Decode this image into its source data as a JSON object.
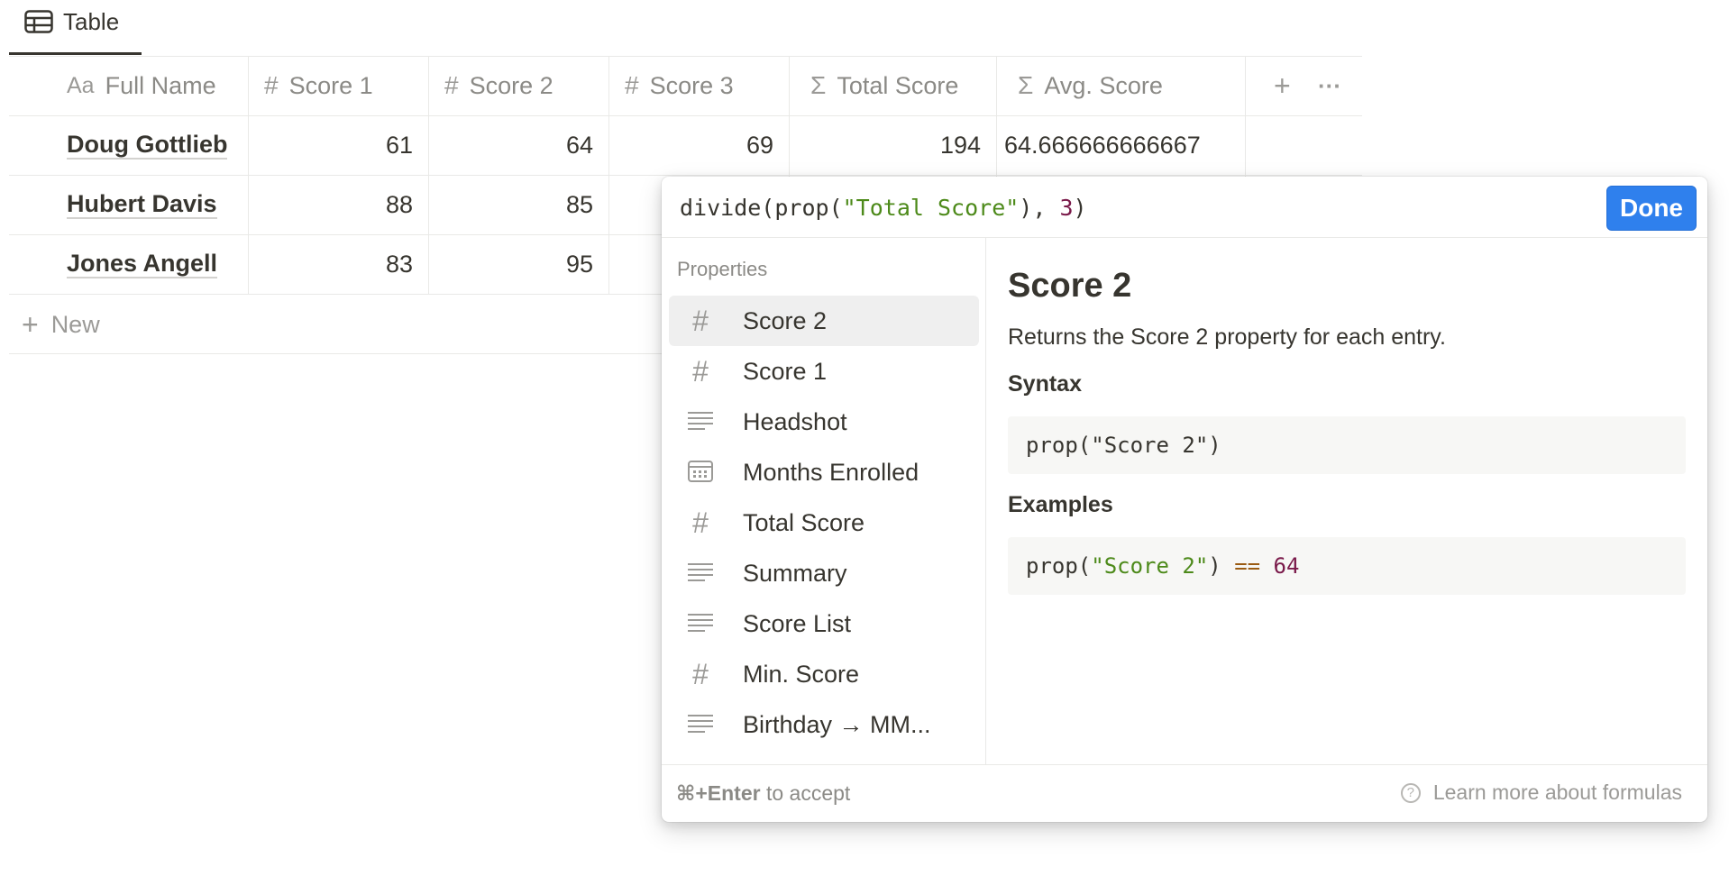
{
  "view_tab": {
    "label": "Table",
    "icon": "table-icon"
  },
  "table": {
    "columns": [
      {
        "label": "Full Name",
        "icon": "Aa"
      },
      {
        "label": "Score 1",
        "icon": "#"
      },
      {
        "label": "Score 2",
        "icon": "#"
      },
      {
        "label": "Score 3",
        "icon": "#"
      },
      {
        "label": "Total Score",
        "icon": "Σ"
      },
      {
        "label": "Avg. Score",
        "icon": "Σ"
      }
    ],
    "add_column_icon": "+",
    "more_icon": "···",
    "rows": [
      {
        "name": "Doug Gottlieb",
        "score1": "61",
        "score2": "64",
        "score3": "69",
        "total": "194",
        "avg": "64.666666666667"
      },
      {
        "name": "Hubert Davis",
        "score1": "88",
        "score2": "85"
      },
      {
        "name": "Jones Angell",
        "score1": "83",
        "score2": "95"
      }
    ],
    "new_row_label": "New"
  },
  "formula_editor": {
    "formula": {
      "fn": "divide(prop(",
      "arg": "\"Total Score\"",
      "sep": "), ",
      "num": "3",
      "close": ")"
    },
    "done_label": "Done",
    "section_label": "Properties",
    "properties": [
      {
        "label": "Score 2",
        "icon": "number-icon",
        "selected": true
      },
      {
        "label": "Score 1",
        "icon": "number-icon"
      },
      {
        "label": "Headshot",
        "icon": "text-icon"
      },
      {
        "label": "Months Enrolled",
        "icon": "calendar-icon"
      },
      {
        "label": "Total Score",
        "icon": "number-icon"
      },
      {
        "label": "Summary",
        "icon": "text-icon"
      },
      {
        "label": "Score List",
        "icon": "text-icon"
      },
      {
        "label": "Min. Score",
        "icon": "number-icon"
      },
      {
        "label": "Birthday → MM...",
        "icon": "text-icon"
      }
    ],
    "doc": {
      "title": "Score 2",
      "description": "Returns the Score 2 property for each entry.",
      "syntax_heading": "Syntax",
      "syntax_code": "prop(\"Score 2\")",
      "examples_heading": "Examples",
      "example": {
        "fn": "prop(",
        "arg": "\"Score 2\"",
        "close": ") ",
        "op": "==",
        "num": " 64"
      }
    },
    "footer": {
      "shortcut": "⌘+Enter",
      "shortcut_suffix": " to accept",
      "help_label": "Learn more about formulas"
    }
  }
}
